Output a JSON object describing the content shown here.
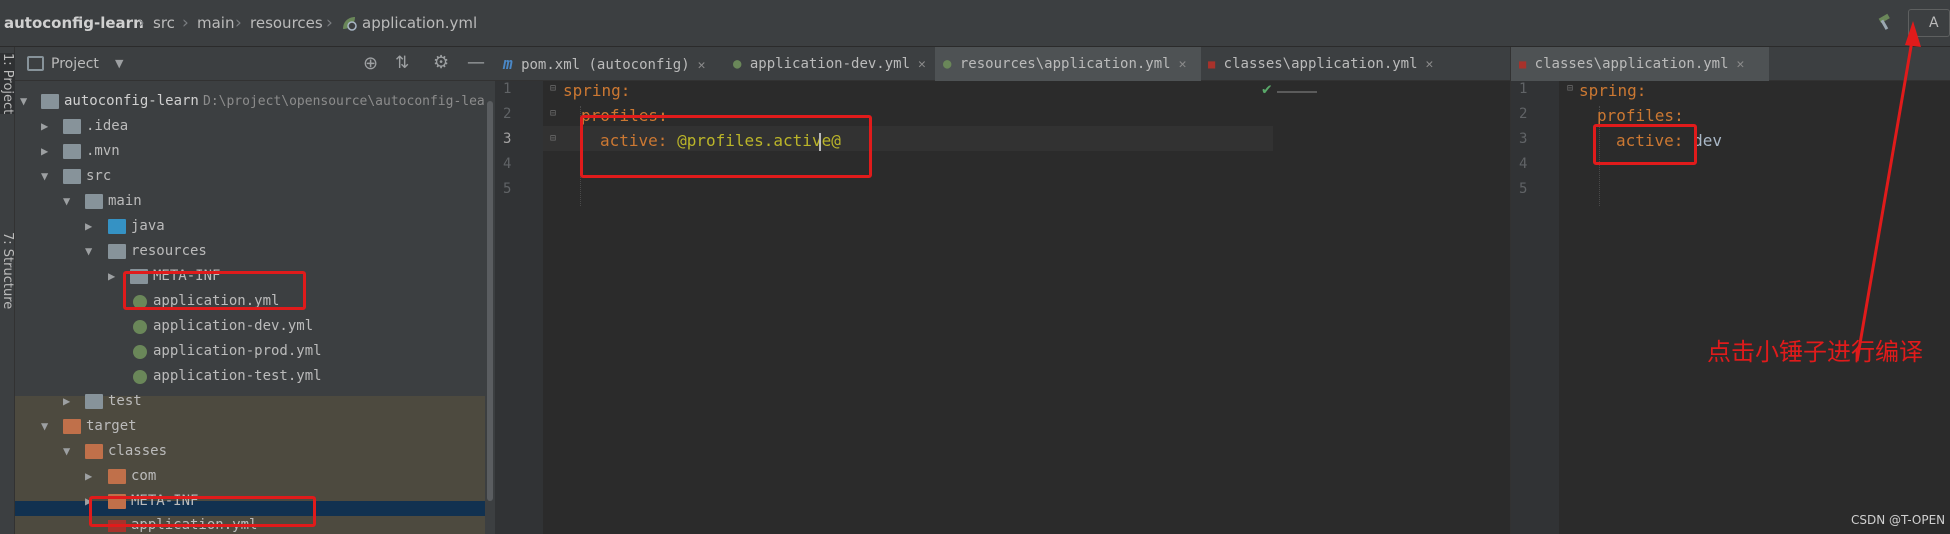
{
  "breadcrumb": {
    "items": [
      "autoconfig-learn",
      "src",
      "main",
      "resources",
      "application.yml"
    ]
  },
  "project_panel": {
    "title": "Project",
    "side_tabs": [
      "1: Project",
      "7: Structure"
    ],
    "tree": [
      {
        "label": "autoconfig-learn",
        "path": "D:\\project\\opensource\\autoconfig-lea"
      },
      {
        "label": ".idea"
      },
      {
        "label": ".mvn"
      },
      {
        "label": "src"
      },
      {
        "label": "main"
      },
      {
        "label": "java"
      },
      {
        "label": "resources"
      },
      {
        "label": "META-INF"
      },
      {
        "label": "application.yml"
      },
      {
        "label": "application-dev.yml"
      },
      {
        "label": "application-prod.yml"
      },
      {
        "label": "application-test.yml"
      },
      {
        "label": "test"
      },
      {
        "label": "target"
      },
      {
        "label": "classes"
      },
      {
        "label": "com"
      },
      {
        "label": "META-INF"
      },
      {
        "label": "application.yml"
      }
    ]
  },
  "tabs_left": [
    {
      "label": "pom.xml (autoconfig)"
    },
    {
      "label": "application-dev.yml"
    },
    {
      "label": "resources\\application.yml"
    },
    {
      "label": "classes\\application.yml"
    }
  ],
  "tabs_right": [
    {
      "label": "classes\\application.yml"
    }
  ],
  "editor_left": {
    "line_numbers": [
      "1",
      "2",
      "3",
      "4",
      "5"
    ],
    "line1_key": "spring",
    "line2_key": "profiles",
    "line3_key": "active",
    "line3_value": "@profiles.active@",
    "colon": ":"
  },
  "editor_right": {
    "line_numbers": [
      "1",
      "2",
      "3",
      "4",
      "5"
    ],
    "line1_key": "spring",
    "line2_key": "profiles",
    "line3_key": "active",
    "line3_value": "dev",
    "colon": ":"
  },
  "annotation": {
    "text": "点击小锤子进行编译",
    "color": "#e01b1b"
  },
  "toolbar": {
    "build_label": "A"
  },
  "watermark": "CSDN @T-OPEN"
}
